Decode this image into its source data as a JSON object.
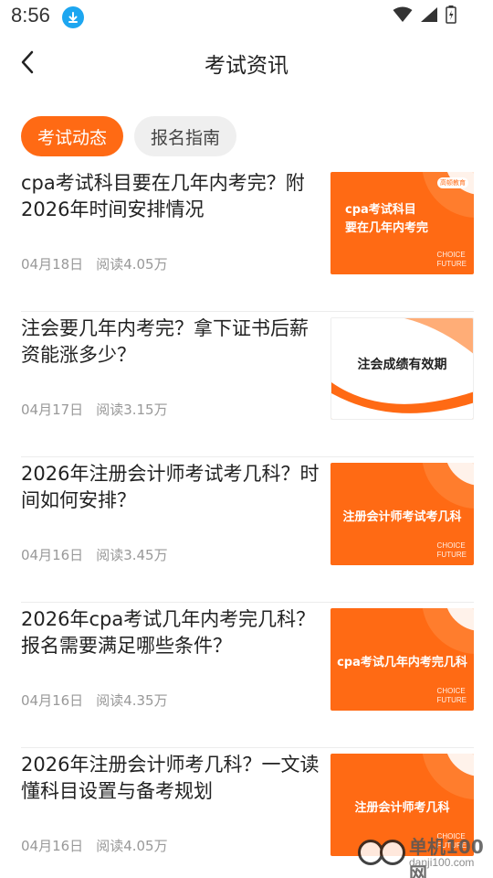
{
  "status_bar": {
    "time": "8:56"
  },
  "header": {
    "title": "考试资讯"
  },
  "tabs": [
    {
      "label": "考试动态",
      "active": true
    },
    {
      "label": "报名指南",
      "active": false
    }
  ],
  "articles": [
    {
      "title": "cpa考试科目要在几年内考完？附2026年时间安排情况",
      "date": "04月18日",
      "reads": "阅读4.05万",
      "thumb_text": "cpa考试科目\n要在几年内考完",
      "thumb_style": "orange"
    },
    {
      "title": "注会要几年内考完？拿下证书后薪资能涨多少？",
      "date": "04月17日",
      "reads": "阅读3.15万",
      "thumb_text": "注会成绩有效期",
      "thumb_style": "white"
    },
    {
      "title": "2026年注册会计师考试考几科？时间如何安排？",
      "date": "04月16日",
      "reads": "阅读3.45万",
      "thumb_text": "注册会计师考试考几科",
      "thumb_style": "orange"
    },
    {
      "title": "2026年cpa考试几年内考完几科？报名需要满足哪些条件？",
      "date": "04月16日",
      "reads": "阅读4.35万",
      "thumb_text": "cpa考试几年内考完几科",
      "thumb_style": "orange"
    },
    {
      "title": "2026年注册会计师考几科？一文读懂科目设置与备考规划",
      "date": "04月16日",
      "reads": "阅读4.05万",
      "thumb_text": "注册会计师考几科",
      "thumb_style": "orange"
    }
  ],
  "thumb_branding": {
    "choice_line1": "CHOICE",
    "choice_line2": "FUTURE",
    "logo": "高顿教育"
  },
  "watermark": {
    "text": "单机100网",
    "url": "danji100.com"
  },
  "colors": {
    "accent": "#ff6a14",
    "tab_inactive_bg": "#efefef",
    "meta_text": "#999999"
  },
  "icons": [
    "download-icon",
    "wifi-icon",
    "signal-icon",
    "battery-icon",
    "back-arrow-icon"
  ]
}
